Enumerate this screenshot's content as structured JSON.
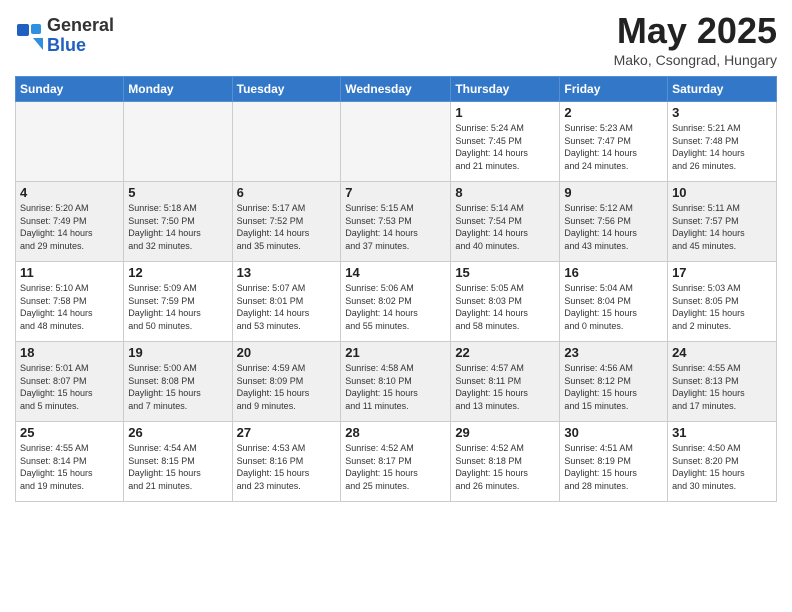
{
  "logo": {
    "general": "General",
    "blue": "Blue"
  },
  "title": "May 2025",
  "subtitle": "Mako, Csongrad, Hungary",
  "weekdays": [
    "Sunday",
    "Monday",
    "Tuesday",
    "Wednesday",
    "Thursday",
    "Friday",
    "Saturday"
  ],
  "weeks": [
    [
      {
        "day": "",
        "info": ""
      },
      {
        "day": "",
        "info": ""
      },
      {
        "day": "",
        "info": ""
      },
      {
        "day": "",
        "info": ""
      },
      {
        "day": "1",
        "info": "Sunrise: 5:24 AM\nSunset: 7:45 PM\nDaylight: 14 hours\nand 21 minutes."
      },
      {
        "day": "2",
        "info": "Sunrise: 5:23 AM\nSunset: 7:47 PM\nDaylight: 14 hours\nand 24 minutes."
      },
      {
        "day": "3",
        "info": "Sunrise: 5:21 AM\nSunset: 7:48 PM\nDaylight: 14 hours\nand 26 minutes."
      }
    ],
    [
      {
        "day": "4",
        "info": "Sunrise: 5:20 AM\nSunset: 7:49 PM\nDaylight: 14 hours\nand 29 minutes."
      },
      {
        "day": "5",
        "info": "Sunrise: 5:18 AM\nSunset: 7:50 PM\nDaylight: 14 hours\nand 32 minutes."
      },
      {
        "day": "6",
        "info": "Sunrise: 5:17 AM\nSunset: 7:52 PM\nDaylight: 14 hours\nand 35 minutes."
      },
      {
        "day": "7",
        "info": "Sunrise: 5:15 AM\nSunset: 7:53 PM\nDaylight: 14 hours\nand 37 minutes."
      },
      {
        "day": "8",
        "info": "Sunrise: 5:14 AM\nSunset: 7:54 PM\nDaylight: 14 hours\nand 40 minutes."
      },
      {
        "day": "9",
        "info": "Sunrise: 5:12 AM\nSunset: 7:56 PM\nDaylight: 14 hours\nand 43 minutes."
      },
      {
        "day": "10",
        "info": "Sunrise: 5:11 AM\nSunset: 7:57 PM\nDaylight: 14 hours\nand 45 minutes."
      }
    ],
    [
      {
        "day": "11",
        "info": "Sunrise: 5:10 AM\nSunset: 7:58 PM\nDaylight: 14 hours\nand 48 minutes."
      },
      {
        "day": "12",
        "info": "Sunrise: 5:09 AM\nSunset: 7:59 PM\nDaylight: 14 hours\nand 50 minutes."
      },
      {
        "day": "13",
        "info": "Sunrise: 5:07 AM\nSunset: 8:01 PM\nDaylight: 14 hours\nand 53 minutes."
      },
      {
        "day": "14",
        "info": "Sunrise: 5:06 AM\nSunset: 8:02 PM\nDaylight: 14 hours\nand 55 minutes."
      },
      {
        "day": "15",
        "info": "Sunrise: 5:05 AM\nSunset: 8:03 PM\nDaylight: 14 hours\nand 58 minutes."
      },
      {
        "day": "16",
        "info": "Sunrise: 5:04 AM\nSunset: 8:04 PM\nDaylight: 15 hours\nand 0 minutes."
      },
      {
        "day": "17",
        "info": "Sunrise: 5:03 AM\nSunset: 8:05 PM\nDaylight: 15 hours\nand 2 minutes."
      }
    ],
    [
      {
        "day": "18",
        "info": "Sunrise: 5:01 AM\nSunset: 8:07 PM\nDaylight: 15 hours\nand 5 minutes."
      },
      {
        "day": "19",
        "info": "Sunrise: 5:00 AM\nSunset: 8:08 PM\nDaylight: 15 hours\nand 7 minutes."
      },
      {
        "day": "20",
        "info": "Sunrise: 4:59 AM\nSunset: 8:09 PM\nDaylight: 15 hours\nand 9 minutes."
      },
      {
        "day": "21",
        "info": "Sunrise: 4:58 AM\nSunset: 8:10 PM\nDaylight: 15 hours\nand 11 minutes."
      },
      {
        "day": "22",
        "info": "Sunrise: 4:57 AM\nSunset: 8:11 PM\nDaylight: 15 hours\nand 13 minutes."
      },
      {
        "day": "23",
        "info": "Sunrise: 4:56 AM\nSunset: 8:12 PM\nDaylight: 15 hours\nand 15 minutes."
      },
      {
        "day": "24",
        "info": "Sunrise: 4:55 AM\nSunset: 8:13 PM\nDaylight: 15 hours\nand 17 minutes."
      }
    ],
    [
      {
        "day": "25",
        "info": "Sunrise: 4:55 AM\nSunset: 8:14 PM\nDaylight: 15 hours\nand 19 minutes."
      },
      {
        "day": "26",
        "info": "Sunrise: 4:54 AM\nSunset: 8:15 PM\nDaylight: 15 hours\nand 21 minutes."
      },
      {
        "day": "27",
        "info": "Sunrise: 4:53 AM\nSunset: 8:16 PM\nDaylight: 15 hours\nand 23 minutes."
      },
      {
        "day": "28",
        "info": "Sunrise: 4:52 AM\nSunset: 8:17 PM\nDaylight: 15 hours\nand 25 minutes."
      },
      {
        "day": "29",
        "info": "Sunrise: 4:52 AM\nSunset: 8:18 PM\nDaylight: 15 hours\nand 26 minutes."
      },
      {
        "day": "30",
        "info": "Sunrise: 4:51 AM\nSunset: 8:19 PM\nDaylight: 15 hours\nand 28 minutes."
      },
      {
        "day": "31",
        "info": "Sunrise: 4:50 AM\nSunset: 8:20 PM\nDaylight: 15 hours\nand 30 minutes."
      }
    ]
  ]
}
